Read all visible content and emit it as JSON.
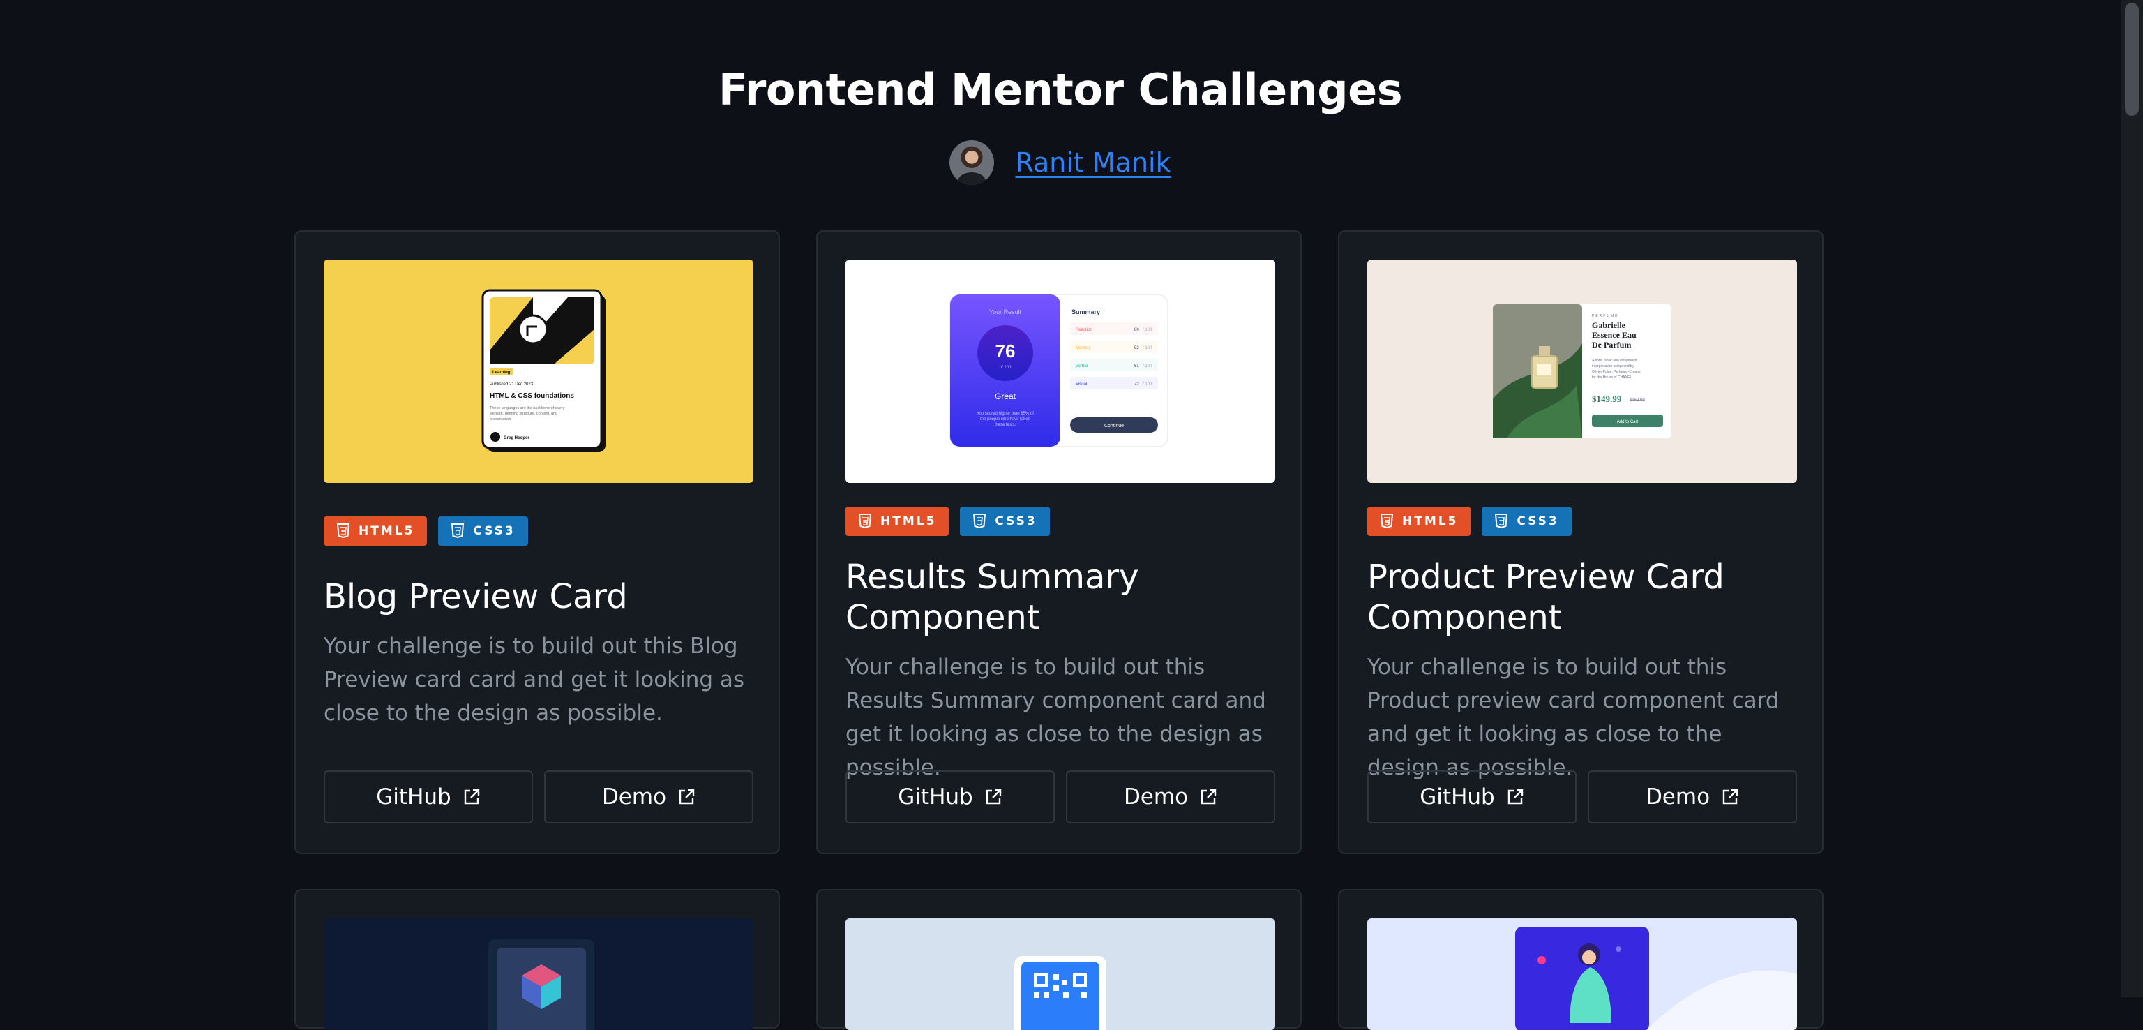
{
  "header": {
    "title": "Frontend Mentor Challenges",
    "author_name": "Ranit Manik"
  },
  "colors": {
    "background": "#0d1117",
    "card": "#161b22",
    "link": "#2f81f7",
    "html_badge": "#e34f26",
    "css_badge": "#1572b6"
  },
  "cards": [
    {
      "badges": [
        "HTML5",
        "CSS3"
      ],
      "title": "Blog Preview Card",
      "description": "Your challenge is to build out this Blog Preview card card and get it looking as close to the design as possible.",
      "github_label": "GitHub",
      "demo_label": "Demo",
      "preview": {
        "tag": "Learning",
        "date": "Published 21 Dec 2023",
        "heading": "HTML & CSS foundations",
        "text": "These languages are the backbone of every website, defining structure, content, and presentation.",
        "author": "Greg Hooper"
      }
    },
    {
      "badges": [
        "HTML5",
        "CSS3"
      ],
      "title": "Results Summary Component",
      "description": "Your challenge is to build out this Results Summary component card and get it looking as close to the design as possible.",
      "github_label": "GitHub",
      "demo_label": "Demo",
      "preview": {
        "result_label": "Your Result",
        "score": "76",
        "score_of": "of 100",
        "rating": "Great",
        "text": "You scored higher than 65% of the people who have taken these tests.",
        "summary_label": "Summary",
        "rows": [
          {
            "name": "Reaction",
            "score": "80",
            "of": "/ 100"
          },
          {
            "name": "Memory",
            "score": "92",
            "of": "/ 100"
          },
          {
            "name": "Verbal",
            "score": "61",
            "of": "/ 100"
          },
          {
            "name": "Visual",
            "score": "72",
            "of": "/ 100"
          }
        ],
        "button": "Continue"
      }
    },
    {
      "badges": [
        "HTML5",
        "CSS3"
      ],
      "title": "Product Preview Card Component",
      "description": "Your challenge is to build out this Product preview card component card and get it looking as close to the design as possible.",
      "github_label": "GitHub",
      "demo_label": "Demo",
      "preview": {
        "category": "PERFUME",
        "name": "Gabrielle Essence Eau De Parfum",
        "text": "A floral, solar and voluptuous interpretation composed by Olivier Polge, Perfumer-Creator for the House of CHANEL.",
        "price": "$149.99",
        "old_price": "$169.99",
        "button": "Add to Cart"
      }
    }
  ]
}
